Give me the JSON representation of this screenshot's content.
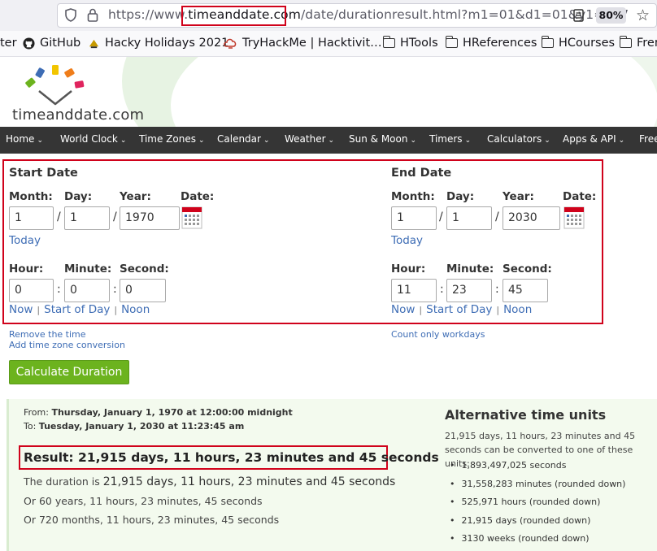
{
  "browser": {
    "url_prefix": "https://www.",
    "url_domain": "timeanddate.com",
    "url_suffix": "/date/durationresult.html?m1=01&d1=01&y1=197",
    "zoom": "80%"
  },
  "bookmarks": [
    {
      "label": "ter",
      "icon": "none"
    },
    {
      "label": "GitHub",
      "icon": "github-icon"
    },
    {
      "label": "Hacky Holidays 2021",
      "icon": "hacky-icon"
    },
    {
      "label": "TryHackMe | Hacktivit…",
      "icon": "tryhackme-icon"
    },
    {
      "label": "HTools",
      "icon": "folder-icon"
    },
    {
      "label": "HReferences",
      "icon": "folder-icon"
    },
    {
      "label": "HCourses",
      "icon": "folder-icon"
    },
    {
      "label": "Fren",
      "icon": "folder-icon"
    }
  ],
  "site": {
    "logo_text": "timeanddate.com"
  },
  "nav": [
    "Home",
    "World Clock",
    "Time Zones",
    "Calendar",
    "Weather",
    "Sun & Moon",
    "Timers",
    "Calculators",
    "Apps & API",
    "Free"
  ],
  "form": {
    "start": {
      "title": "Start Date",
      "month_label": "Month:",
      "day_label": "Day:",
      "year_label": "Year:",
      "date_label": "Date:",
      "month": "1",
      "day": "1",
      "year": "1970",
      "today_link": "Today",
      "hour_label": "Hour:",
      "minute_label": "Minute:",
      "second_label": "Second:",
      "hour": "0",
      "minute": "0",
      "second": "0",
      "now_link": "Now",
      "start_of_day_link": "Start of Day",
      "noon_link": "Noon"
    },
    "end": {
      "title": "End Date",
      "month_label": "Month:",
      "day_label": "Day:",
      "year_label": "Year:",
      "date_label": "Date:",
      "month": "1",
      "day": "1",
      "year": "2030",
      "today_link": "Today",
      "hour_label": "Hour:",
      "minute_label": "Minute:",
      "second_label": "Second:",
      "hour": "11",
      "minute": "23",
      "second": "45",
      "now_link": "Now",
      "start_of_day_link": "Start of Day",
      "noon_link": "Noon"
    },
    "remove_time_link": "Remove the time",
    "add_tz_link": "Add time zone conversion",
    "workdays_link": "Count only workdays",
    "calculate_button": "Calculate Duration"
  },
  "results": {
    "from_label": "From:",
    "from_value": "Thursday, January 1, 1970 at 12:00:00 midnight",
    "to_label": "To:",
    "to_value": "Tuesday, January 1, 2030 at 11:23:45 am",
    "result": "Result: 21,915 days, 11 hours, 23 minutes and 45 seconds",
    "duration_prefix": "The duration is",
    "duration_value": "21,915 days, 11 hours, 23 minutes and 45 seconds",
    "years_line": "Or 60 years, 11 hours, 23 minutes, 45 seconds",
    "months_line": "Or 720 months, 11 hours, 23 minutes, 45 seconds",
    "alt_title": "Alternative time units",
    "alt_desc": "21,915 days, 11 hours, 23 minutes and 45 seconds can be converted to one of these units:",
    "alt_units": [
      "1,893,497,025 seconds",
      "31,558,283 minutes (rounded down)",
      "525,971 hours (rounded down)",
      "21,915 days (rounded down)",
      "3130 weeks (rounded down)"
    ]
  }
}
